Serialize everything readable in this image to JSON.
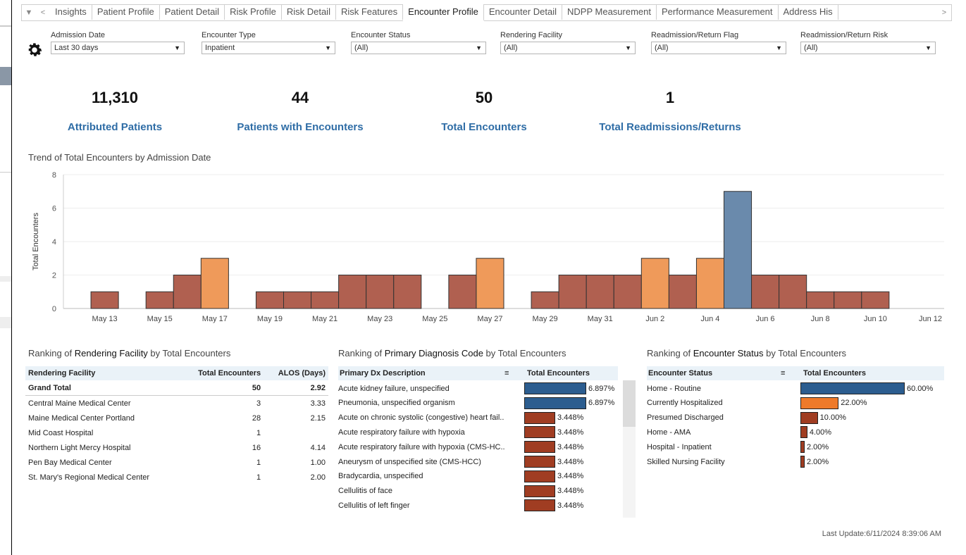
{
  "tabs": [
    "Insights",
    "Patient Profile",
    "Patient Detail",
    "Risk Profile",
    "Risk Detail",
    "Risk Features",
    "Encounter Profile",
    "Encounter Detail",
    "NDPP Measurement",
    "Performance Measurement",
    "Address His"
  ],
  "active_tab": "Encounter Profile",
  "filters": [
    {
      "label": "Admission Date",
      "value": "Last 30 days"
    },
    {
      "label": "Encounter Type",
      "value": "Inpatient"
    },
    {
      "label": "Encounter Status",
      "value": "(All)"
    },
    {
      "label": "Rendering Facility",
      "value": "(All)"
    },
    {
      "label": "Readmission/Return Flag",
      "value": "(All)"
    },
    {
      "label": "Readmission/Return Risk",
      "value": "(All)"
    }
  ],
  "kpis": [
    {
      "value": "11,310",
      "label": "Attributed Patients"
    },
    {
      "value": "44",
      "label": "Patients with Encounters"
    },
    {
      "value": "50",
      "label": "Total Encounters"
    },
    {
      "value": "1",
      "label": "Total Readmissions/Returns"
    }
  ],
  "trend_title": "Trend of Total Encounters by Admission Date",
  "chart_data": {
    "type": "bar",
    "title": "Trend of Total Encounters by Admission Date",
    "ylabel": "Total Encounters",
    "ylim": [
      0,
      8
    ],
    "yticks": [
      0,
      2,
      4,
      6,
      8
    ],
    "xticks": [
      "May 13",
      "May 15",
      "May 17",
      "May 19",
      "May 21",
      "May 23",
      "May 25",
      "May 27",
      "May 29",
      "May 31",
      "Jun 2",
      "Jun 4",
      "Jun 6",
      "Jun 8",
      "Jun 10",
      "Jun 12"
    ],
    "bars": [
      {
        "x": "May 13",
        "value": 1,
        "color": "#b06050"
      },
      {
        "x": "May 15",
        "value": 1,
        "color": "#b06050"
      },
      {
        "x": "May 16",
        "value": 2,
        "color": "#b06050"
      },
      {
        "x": "May 17",
        "value": 3,
        "color": "#ef9a5a"
      },
      {
        "x": "May 19",
        "value": 1,
        "color": "#b06050"
      },
      {
        "x": "May 20",
        "value": 1,
        "color": "#b06050"
      },
      {
        "x": "May 21",
        "value": 1,
        "color": "#b06050"
      },
      {
        "x": "May 22",
        "value": 2,
        "color": "#b06050"
      },
      {
        "x": "May 23",
        "value": 2,
        "color": "#b06050"
      },
      {
        "x": "May 24",
        "value": 2,
        "color": "#b06050"
      },
      {
        "x": "May 26",
        "value": 2,
        "color": "#b06050"
      },
      {
        "x": "May 27",
        "value": 3,
        "color": "#ef9a5a"
      },
      {
        "x": "May 29",
        "value": 1,
        "color": "#b06050"
      },
      {
        "x": "May 30",
        "value": 2,
        "color": "#b06050"
      },
      {
        "x": "May 31",
        "value": 2,
        "color": "#b06050"
      },
      {
        "x": "Jun 1",
        "value": 2,
        "color": "#b06050"
      },
      {
        "x": "Jun 2",
        "value": 3,
        "color": "#ef9a5a"
      },
      {
        "x": "Jun 3",
        "value": 2,
        "color": "#b06050"
      },
      {
        "x": "Jun 4",
        "value": 3,
        "color": "#ef9a5a"
      },
      {
        "x": "Jun 5",
        "value": 7,
        "color": "#6a8aac"
      },
      {
        "x": "Jun 6",
        "value": 2,
        "color": "#b06050"
      },
      {
        "x": "Jun 7",
        "value": 2,
        "color": "#b06050"
      },
      {
        "x": "Jun 8",
        "value": 1,
        "color": "#b06050"
      },
      {
        "x": "Jun 9",
        "value": 1,
        "color": "#b06050"
      },
      {
        "x": "Jun 10",
        "value": 1,
        "color": "#b06050"
      }
    ]
  },
  "facility": {
    "title_prefix": "Ranking of ",
    "title_bold": "Rendering Facility",
    "title_suffix": " by Total Encounters",
    "headers": [
      "Rendering Facility",
      "Total Encounters",
      "ALOS (Days)"
    ],
    "grand_total": [
      "Grand Total",
      "50",
      "2.92"
    ],
    "rows": [
      [
        "Central Maine Medical Center",
        "3",
        "3.33"
      ],
      [
        "Maine Medical Center Portland",
        "28",
        "2.15"
      ],
      [
        "Mid Coast Hospital",
        "1",
        ""
      ],
      [
        "Northern Light Mercy Hospital",
        "16",
        "4.14"
      ],
      [
        "Pen Bay Medical Center",
        "1",
        "1.00"
      ],
      [
        "St. Mary's Regional Medical Center",
        "1",
        "2.00"
      ]
    ]
  },
  "diagnosis": {
    "title_prefix": "Ranking of ",
    "title_bold": "Primary Diagnosis Code",
    "title_suffix": " by Total Encounters",
    "headers": [
      "Primary Dx Description",
      "Total Encounters"
    ],
    "rows": [
      {
        "label": "Acute kidney failure, unspecified",
        "pct": "6.897%",
        "value": 6.897,
        "color": "#2c5d8f"
      },
      {
        "label": "Pneumonia, unspecified organism",
        "pct": "6.897%",
        "value": 6.897,
        "color": "#2c5d8f"
      },
      {
        "label": "Acute on chronic systolic (congestive) heart fail..",
        "pct": "3.448%",
        "value": 3.448,
        "color": "#a03d22"
      },
      {
        "label": "Acute respiratory failure with hypoxia",
        "pct": "3.448%",
        "value": 3.448,
        "color": "#a03d22"
      },
      {
        "label": "Acute respiratory failure with hypoxia (CMS-HC..",
        "pct": "3.448%",
        "value": 3.448,
        "color": "#a03d22"
      },
      {
        "label": "Aneurysm of unspecified site (CMS-HCC)",
        "pct": "3.448%",
        "value": 3.448,
        "color": "#a03d22"
      },
      {
        "label": "Bradycardia, unspecified",
        "pct": "3.448%",
        "value": 3.448,
        "color": "#a03d22"
      },
      {
        "label": "Cellulitis of face",
        "pct": "3.448%",
        "value": 3.448,
        "color": "#a03d22"
      },
      {
        "label": "Cellulitis of left finger",
        "pct": "3.448%",
        "value": 3.448,
        "color": "#a03d22"
      }
    ]
  },
  "status": {
    "title_prefix": "Ranking of ",
    "title_bold": "Encounter Status",
    "title_suffix": " by Total Encounters",
    "headers": [
      "Encounter Status",
      "Total Encounters"
    ],
    "rows": [
      {
        "label": "Home - Routine",
        "pct": "60.00%",
        "value": 60,
        "color": "#2c5d8f"
      },
      {
        "label": "Currently Hospitalized",
        "pct": "22.00%",
        "value": 22,
        "color": "#ee7a2a"
      },
      {
        "label": "Presumed Discharged",
        "pct": "10.00%",
        "value": 10,
        "color": "#a03d22"
      },
      {
        "label": "Home - AMA",
        "pct": "4.00%",
        "value": 4,
        "color": "#a03d22"
      },
      {
        "label": "Hospital - Inpatient",
        "pct": "2.00%",
        "value": 2,
        "color": "#a03d22"
      },
      {
        "label": "Skilled Nursing Facility",
        "pct": "2.00%",
        "value": 2,
        "color": "#a03d22"
      }
    ]
  },
  "last_update": "Last Update:6/11/2024 8:39:06 AM"
}
